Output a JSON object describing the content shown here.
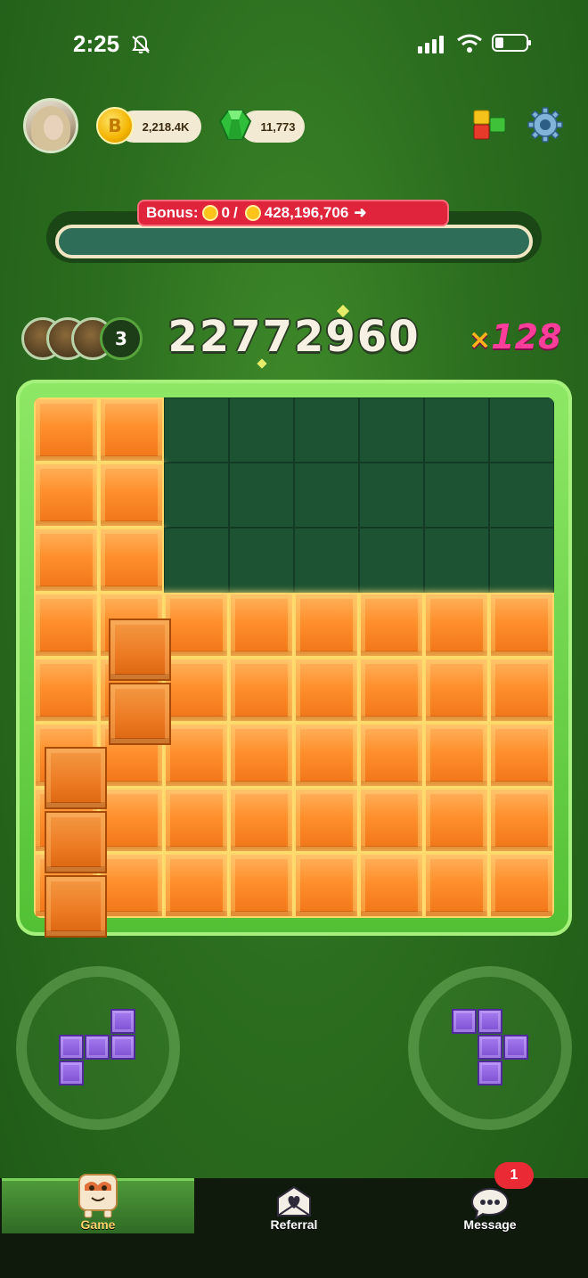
{
  "status_bar": {
    "time": "2:25",
    "icons": [
      "bell-muted-icon",
      "signal-icon",
      "wifi-icon",
      "battery-icon"
    ]
  },
  "header": {
    "coins": "2,218.4K",
    "gems": "11,773",
    "icons": [
      "avatar",
      "coin-icon",
      "gem-icon",
      "blocks-icon",
      "gear-icon"
    ]
  },
  "bonus": {
    "label": "Bonus:",
    "current": "0",
    "separator": "/",
    "target": "428,196,706",
    "arrow": "➜",
    "progress": 0
  },
  "players": {
    "count": "3"
  },
  "score": "22772960",
  "multiplier": {
    "prefix": "×",
    "value": "128"
  },
  "board": {
    "rows": 8,
    "cols": 8,
    "filled_color": "#ff8f2c",
    "empty_color": "#1d5233",
    "grid": [
      [
        1,
        1,
        0,
        0,
        0,
        0,
        0,
        0
      ],
      [
        1,
        1,
        0,
        0,
        0,
        0,
        0,
        0
      ],
      [
        1,
        1,
        0,
        0,
        0,
        0,
        0,
        0
      ],
      [
        1,
        1,
        1,
        1,
        1,
        1,
        1,
        1
      ],
      [
        1,
        1,
        1,
        1,
        1,
        1,
        1,
        1
      ],
      [
        1,
        1,
        1,
        1,
        1,
        1,
        1,
        1
      ],
      [
        1,
        1,
        1,
        1,
        1,
        1,
        1,
        1
      ],
      [
        1,
        1,
        1,
        1,
        1,
        1,
        1,
        1
      ]
    ]
  },
  "pieces": {
    "left": "purple S-piece",
    "right": "purple T-piece",
    "color": "#8e5fe0"
  },
  "tabs": [
    {
      "label": "Game",
      "active": true
    },
    {
      "label": "Referral",
      "active": false
    },
    {
      "label": "Message",
      "active": false,
      "badge": "1"
    }
  ]
}
